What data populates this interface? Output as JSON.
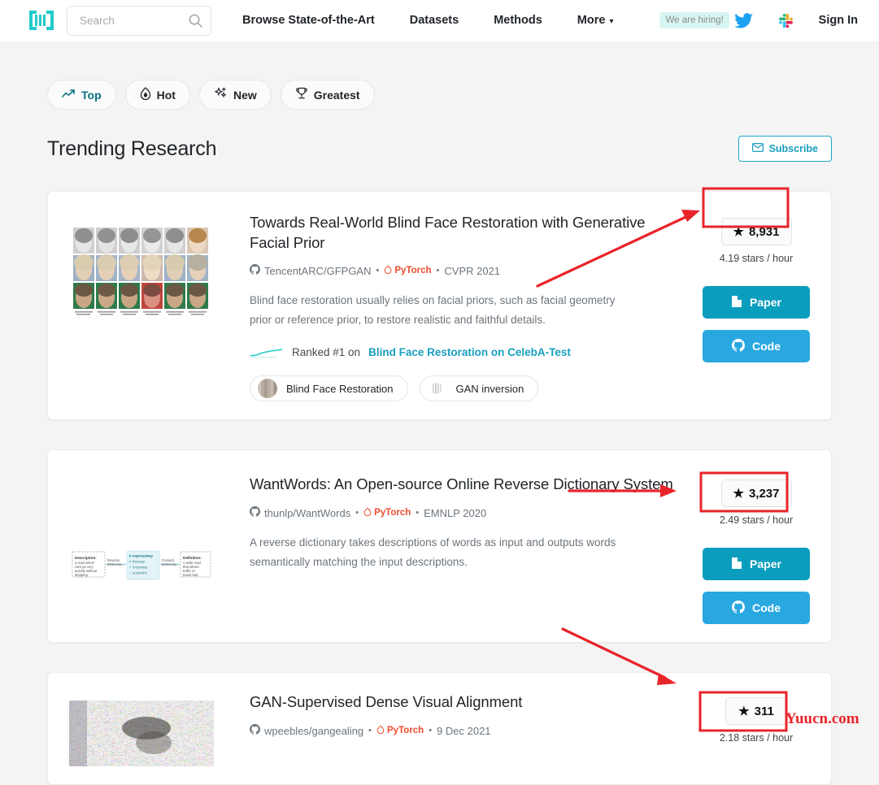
{
  "header": {
    "logo_icon": "paperswithcode-logo",
    "search": {
      "placeholder": "Search",
      "value": "",
      "icon": "search-icon"
    },
    "nav": [
      {
        "label": "Browse State-of-the-Art"
      },
      {
        "label": "Datasets"
      },
      {
        "label": "Methods"
      },
      {
        "label": "More",
        "caret": "⌄"
      }
    ],
    "hiring_badge": "We are hiring!",
    "twitter_icon": "twitter-icon",
    "slack_icon": "slack-icon",
    "sign_in": "Sign In"
  },
  "filters": [
    {
      "label": "Top",
      "icon": "trending-up-icon",
      "active": true
    },
    {
      "label": "Hot",
      "icon": "flame-icon",
      "active": false
    },
    {
      "label": "New",
      "icon": "sparkles-icon",
      "active": false
    },
    {
      "label": "Greatest",
      "icon": "trophy-icon",
      "active": false
    }
  ],
  "page_title": "Trending Research",
  "subscribe": {
    "label": "Subscribe",
    "icon": "envelope-icon"
  },
  "papers": [
    {
      "thumbnail": "face-restoration-grid",
      "title": "Towards Real-World Blind Face Restoration with Generative Facial Prior",
      "repo": "TencentARC/GFPGAN",
      "framework": "PyTorch",
      "venue": "CVPR 2021",
      "abstract": "Blind face restoration usually relies on facial priors, such as facial geometry prior or reference prior, to restore realistic and faithful details.",
      "ranked_prefix": "Ranked #1 on",
      "ranked_link": "Blind Face Restoration on CelebA-Test",
      "tags": [
        {
          "label": "Blind Face Restoration",
          "thumb": "face-thumb"
        },
        {
          "label": "GAN inversion",
          "thumb": "gan-thumb"
        }
      ],
      "stars": "8,931",
      "stars_rate": "4.19 stars / hour",
      "paper_button": "Paper",
      "code_button": "Code"
    },
    {
      "thumbnail": "reverse-dictionary-diagram",
      "title": "WantWords: An Open-source Online Reverse Dictionary System",
      "repo": "thunlp/WantWords",
      "framework": "PyTorch",
      "venue": "EMNLP 2020",
      "abstract": "A reverse dictionary takes descriptions of words as input and outputs words semantically matching the input descriptions.",
      "ranked_prefix": "",
      "ranked_link": "",
      "tags": [],
      "stars": "3,237",
      "stars_rate": "2.49 stars / hour",
      "paper_button": "Paper",
      "code_button": "Code"
    },
    {
      "thumbnail": "dense-alignment-noise",
      "title": "GAN-Supervised Dense Visual Alignment",
      "repo": "wpeebles/gangealing",
      "framework": "PyTorch",
      "venue": "9 Dec 2021",
      "abstract": "",
      "ranked_prefix": "",
      "ranked_link": "",
      "tags": [],
      "stars": "311",
      "stars_rate": "2.18 stars / hour",
      "paper_button": "",
      "code_button": ""
    }
  ],
  "diagram_labels": {
    "description_title": "Description:",
    "description_body": "a road where cars go very quickly without stopping",
    "reverse_label": "Reverse Dictionary",
    "forward_label": "Forward Dictionary",
    "words": [
      "expressway",
      "freeway",
      "motorway",
      "autobahn"
    ],
    "definition_title": "Definition:",
    "definition_body": "A wide road that allows traffic to travel fast."
  },
  "annotations": {
    "watermark": "Yuucn.com",
    "highlight_color": "#e8242a",
    "arrow_color": "#e8242a"
  },
  "colors": {
    "brand_teal": "#21cbca",
    "link_blue": "#1a9fc0",
    "paper_button": "#0b9dbd",
    "code_button": "#29a8e0",
    "background": "#f4f4f4",
    "pytorch_red": "#ee4c2c"
  }
}
